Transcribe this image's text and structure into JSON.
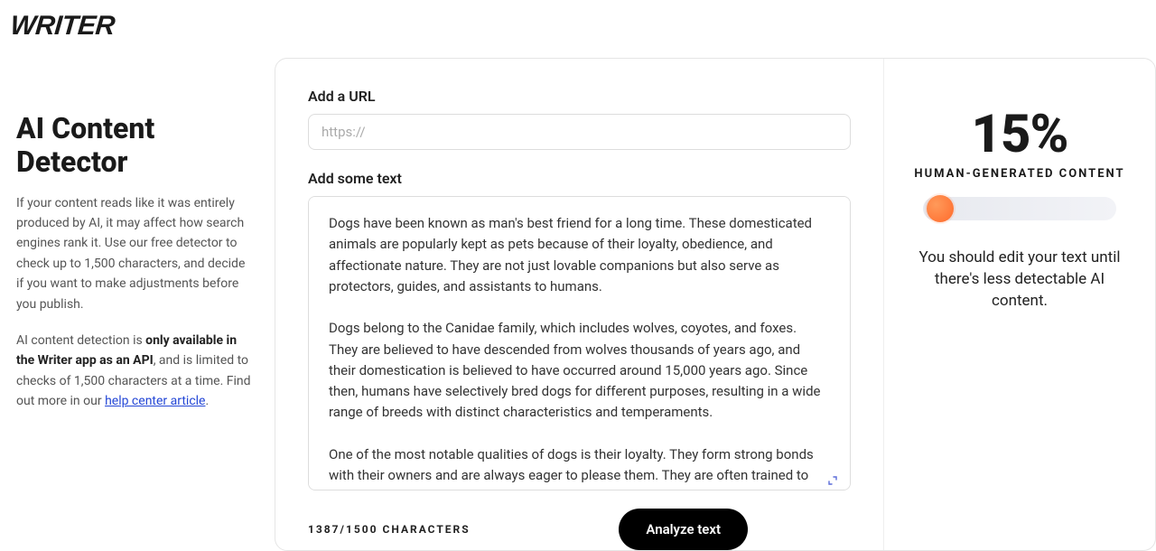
{
  "brand": "WRITER",
  "left": {
    "heading": "AI Content Detector",
    "para1": "If your content reads like it was entirely produced by AI, it may affect how search engines rank it. Use our free detector to check up to 1,500 characters, and decide if you want to make adjustments before you publish.",
    "para2_prefix": "AI content detection is ",
    "para2_bold": "only available in the Writer app as an API",
    "para2_mid": ", and is limited to checks of 1,500 characters at a time. Find out more in our ",
    "para2_link": "help center article",
    "para2_suffix": "."
  },
  "center": {
    "url_label": "Add a URL",
    "url_placeholder": "https://",
    "text_label": "Add some text",
    "text_value": "Dogs have been known as man's best friend for a long time. These domesticated animals are popularly kept as pets because of their loyalty, obedience, and affectionate nature. They are not just lovable companions but also serve as protectors, guides, and assistants to humans.\n\nDogs belong to the Canidae family, which includes wolves, coyotes, and foxes. They are believed to have descended from wolves thousands of years ago, and their domestication is believed to have occurred around 15,000 years ago. Since then, humans have selectively bred dogs for different purposes, resulting in a wide range of breeds with distinct characteristics and temperaments.\n\nOne of the most notable qualities of dogs is their loyalty. They form strong bonds with their owners and are always eager to please them. They are often trained to be protectors of their owners and their property. They can sense",
    "char_count": "1387/1500 CHARACTERS",
    "analyze_label": "Analyze text"
  },
  "right": {
    "percent": "15%",
    "label": "HUMAN-GENERATED CONTENT",
    "advice": "You should edit your text until there's less detectable AI content."
  }
}
